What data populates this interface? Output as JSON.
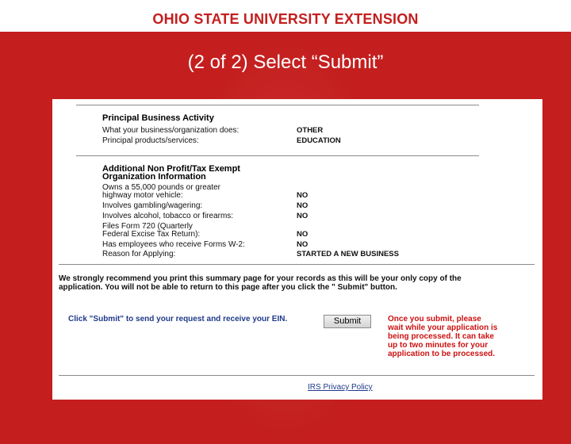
{
  "banner": {
    "title": "OHIO STATE UNIVERSITY EXTENSION"
  },
  "slide": {
    "title": "(2 of 2) Select “Submit”"
  },
  "principal": {
    "heading": "Principal Business Activity",
    "rows": [
      {
        "label": "What your business/organization does:",
        "value": "OTHER"
      },
      {
        "label": "Principal products/services:",
        "value": "EDUCATION"
      }
    ]
  },
  "nonprofit": {
    "heading_line1": "Additional Non Profit/Tax Exempt",
    "heading_line2": "Organization Information",
    "rows": [
      {
        "label_line1": "Owns a 55,000 pounds or greater",
        "label_line2": "highway motor vehicle:",
        "value": "NO"
      },
      {
        "label_line1": "Involves gambling/wagering:",
        "label_line2": "",
        "value": "NO"
      },
      {
        "label_line1": "Involves alcohol, tobacco or firearms:",
        "label_line2": "",
        "value": "NO"
      },
      {
        "label_line1": "Files Form 720 (Quarterly",
        "label_line2": "Federal Excise Tax Return):",
        "value": "NO"
      },
      {
        "label_line1": "Has employees who receive Forms W-2:",
        "label_line2": "",
        "value": "NO"
      },
      {
        "label_line1": "Reason for Applying:",
        "label_line2": "",
        "value": "STARTED A NEW BUSINESS"
      }
    ]
  },
  "recommend_text": "We strongly recommend you print this summary page for your records as this will be your only copy of the application. You will not be able to return to this page after you click the \" Submit\" button.",
  "click_text": "Click \"Submit\" to send your request and receive your EIN.",
  "submit_label": "Submit",
  "warning_text": "Once you submit, please wait while your application is being processed. It can take up to two minutes for your application to be processed.",
  "privacy_link": "IRS Privacy Policy"
}
